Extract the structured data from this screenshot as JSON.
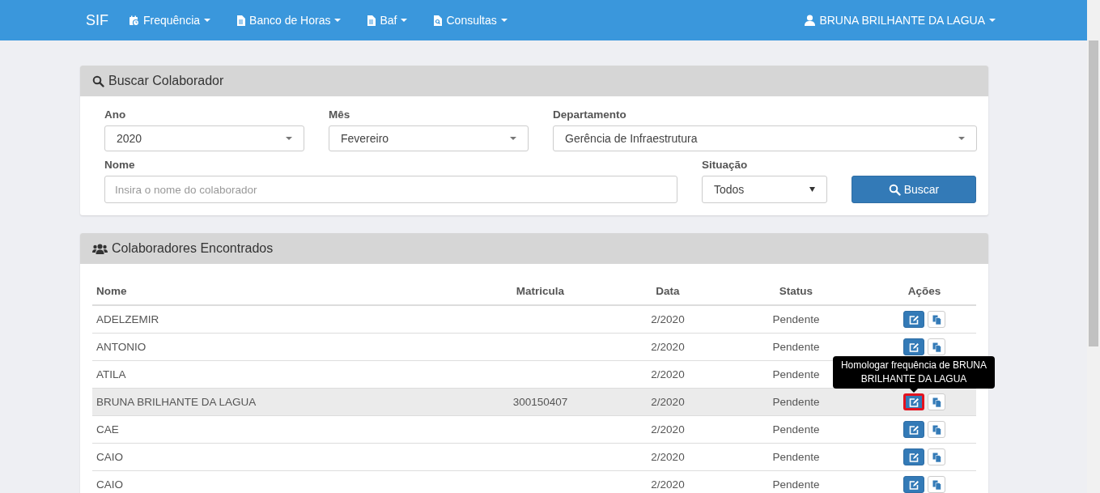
{
  "navbar": {
    "brand": "SIF",
    "menus": [
      {
        "label": "Frequência"
      },
      {
        "label": "Banco de Horas"
      },
      {
        "label": "Baf"
      },
      {
        "label": "Consultas"
      }
    ],
    "user": "BRUNA BRILHANTE DA LAGUA"
  },
  "search_panel": {
    "title": "Buscar Colaborador",
    "ano": {
      "label": "Ano",
      "value": "2020"
    },
    "mes": {
      "label": "Mês",
      "value": "Fevereiro"
    },
    "departamento": {
      "label": "Departamento",
      "value": "Gerência de Infraestrutura"
    },
    "nome": {
      "label": "Nome",
      "placeholder": "Insira o nome do colaborador"
    },
    "situacao": {
      "label": "Situação",
      "value": "Todos"
    },
    "button": "Buscar"
  },
  "results_panel": {
    "title": "Colaboradores Encontrados",
    "columns": [
      "Nome",
      "Matricula",
      "Data",
      "Status",
      "Ações"
    ],
    "rows": [
      {
        "name": "ADELZEMIR",
        "matricula": "",
        "data": "2/2020",
        "status": "Pendente",
        "highlighted": false
      },
      {
        "name": "ANTONIO",
        "matricula": "",
        "data": "2/2020",
        "status": "Pendente",
        "highlighted": false
      },
      {
        "name": "ATILA",
        "matricula": "",
        "data": "2/2020",
        "status": "Pendente",
        "highlighted": false
      },
      {
        "name": "BRUNA BRILHANTE DA LAGUA",
        "matricula": "300150407",
        "data": "2/2020",
        "status": "Pendente",
        "highlighted": true,
        "tooltip": "Homologar frequência de BRUNA BRILHANTE DA LAGUA"
      },
      {
        "name": "CAE",
        "matricula": "",
        "data": "2/2020",
        "status": "Pendente",
        "highlighted": false
      },
      {
        "name": "CAIO",
        "matricula": "",
        "data": "2/2020",
        "status": "Pendente",
        "highlighted": false
      },
      {
        "name": "CAIO",
        "matricula": "",
        "data": "2/2020",
        "status": "Pendente",
        "highlighted": false
      }
    ]
  }
}
